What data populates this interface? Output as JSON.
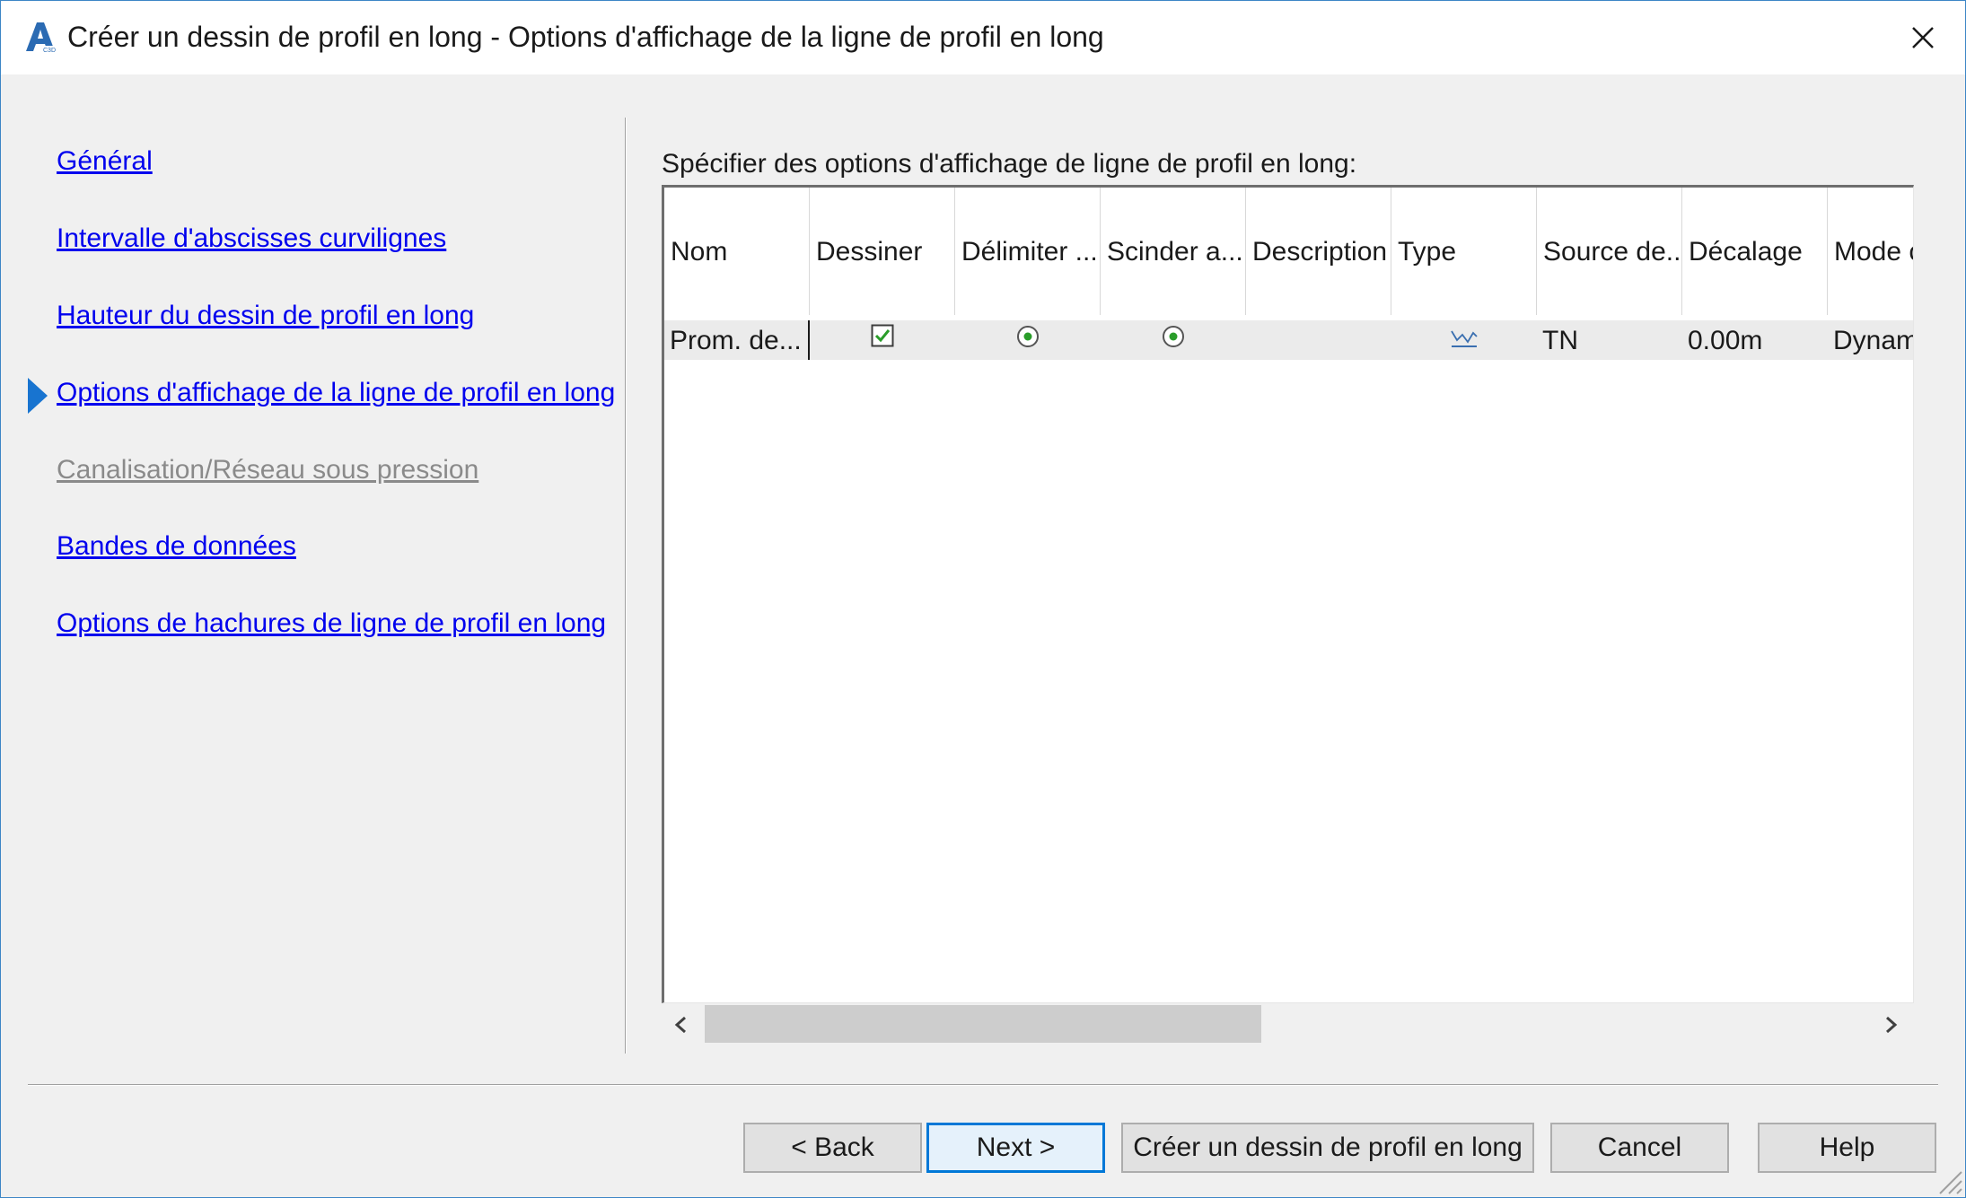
{
  "window": {
    "title": "Créer un dessin de profil en long - Options d'affichage de la ligne de profil en long",
    "app_icon": "autocad-civil3d-icon",
    "close_icon": "close-icon"
  },
  "nav": {
    "items": [
      {
        "label": "Général",
        "state": "link"
      },
      {
        "label": "Intervalle d'abscisses curvilignes",
        "state": "link"
      },
      {
        "label": "Hauteur du dessin de profil en long",
        "state": "link"
      },
      {
        "label": "Options d'affichage de la ligne de profil en long",
        "state": "current"
      },
      {
        "label": "Canalisation/Réseau sous pression",
        "state": "disabled"
      },
      {
        "label": "Bandes de données",
        "state": "link"
      },
      {
        "label": "Options de hachures de ligne de profil en long",
        "state": "link"
      }
    ],
    "current_marker_color": "#1874d0"
  },
  "panel": {
    "label": "Spécifier des options d'affichage de ligne de profil en long:",
    "columns": [
      "Nom",
      "Dessiner",
      "Délimiter ...",
      "Scinder a...",
      "Description",
      "Type",
      "Source de...",
      "Décalage",
      "Mode c"
    ],
    "rows": [
      {
        "nom": "Prom. de...",
        "dessiner": true,
        "delimiter": "selected",
        "scinder": "selected",
        "description": "",
        "type_icon": "profile-type-icon",
        "source": "TN",
        "decalage": "0.00m",
        "mode": "Dynam"
      }
    ],
    "scrollbar": {
      "left_icon": "chevron-left-icon",
      "right_icon": "chevron-right-icon"
    }
  },
  "buttons": {
    "back": "< Back",
    "next": "Next >",
    "create": "Créer un dessin de profil en long",
    "cancel": "Cancel",
    "help": "Help"
  },
  "colors": {
    "accent": "#0078d7",
    "link": "#0000ee",
    "disabled": "#8a8a8a",
    "checkbox_green": "#2a9d2a",
    "radio_green": "#2a9d2a"
  }
}
